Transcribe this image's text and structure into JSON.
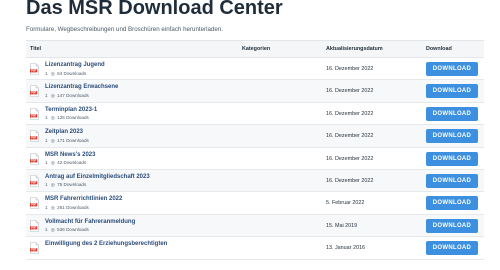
{
  "page": {
    "title": "Das MSR Download Center",
    "subtitle": "Formulare, Wegbeschreibungen und Broschüren einfach herunterladen."
  },
  "table": {
    "headers": {
      "title": "Titel",
      "categories": "Kategorien",
      "updated": "Aktualisierungsdatum",
      "download": "Download"
    },
    "rows": [
      {
        "name": "Lizenzantrag Jugend",
        "version": "1",
        "downloads": "64 Downloads",
        "category": "",
        "date": "16. Dezember 2022",
        "button": "DOWNLOAD"
      },
      {
        "name": "Lizenzantrag Erwachsene",
        "version": "1",
        "downloads": "147 Downloads",
        "category": "",
        "date": "16. Dezember 2022",
        "button": "DOWNLOAD"
      },
      {
        "name": "Terminplan 2023-1",
        "version": "1",
        "downloads": "125 Downloads",
        "category": "",
        "date": "16. Dezember 2022",
        "button": "DOWNLOAD"
      },
      {
        "name": "Zeitplan 2023",
        "version": "1",
        "downloads": "171 Downloads",
        "category": "",
        "date": "16. Dezember 2022",
        "button": "DOWNLOAD"
      },
      {
        "name": "MSR News's 2023",
        "version": "1",
        "downloads": "42 Downloads",
        "category": "",
        "date": "16. Dezember 2022",
        "button": "DOWNLOAD"
      },
      {
        "name": "Antrag auf Einzelmitgliedschaft 2023",
        "version": "1",
        "downloads": "75 Downloads",
        "category": "",
        "date": "16. Dezember 2022",
        "button": "DOWNLOAD"
      },
      {
        "name": "MSR Fahrerrichtlinien 2022",
        "version": "1",
        "downloads": "261 Downloads",
        "category": "",
        "date": "5. Februar 2022",
        "button": "DOWNLOAD"
      },
      {
        "name": "Vollmacht für Fahreranmeldung",
        "version": "1",
        "downloads": "536 Downloads",
        "category": "",
        "date": "15. Mai 2019",
        "button": "DOWNLOAD"
      },
      {
        "name": "Einwilligung des 2 Erziehungsberechtigten",
        "version": "1",
        "downloads": "",
        "category": "",
        "date": "13. Januar 2016",
        "button": "DOWNLOAD"
      }
    ]
  },
  "colors": {
    "button": "#3d8fe0",
    "link": "#2a4d7a",
    "pdf_red": "#d93a2b"
  },
  "icons": {
    "file": "pdf-icon",
    "downloads": "eye-icon"
  }
}
